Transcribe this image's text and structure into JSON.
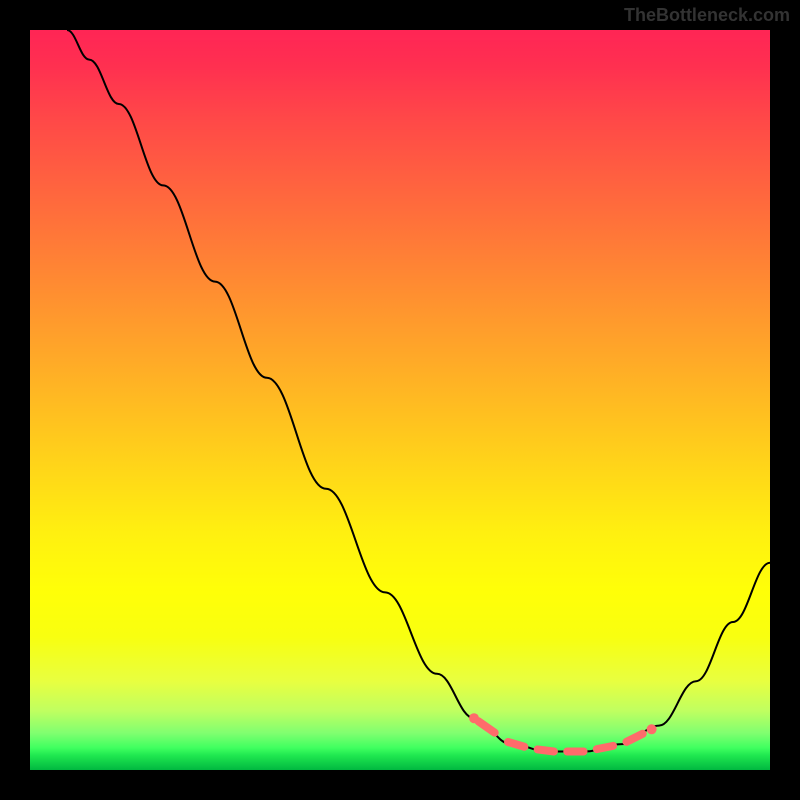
{
  "watermark": "TheBottleneck.com",
  "chart_data": {
    "type": "line",
    "title": "",
    "xlabel": "",
    "ylabel": "",
    "xlim": [
      0,
      100
    ],
    "ylim": [
      0,
      100
    ],
    "curve_points": [
      {
        "x": 5,
        "y": 100
      },
      {
        "x": 8,
        "y": 96
      },
      {
        "x": 12,
        "y": 90
      },
      {
        "x": 18,
        "y": 79
      },
      {
        "x": 25,
        "y": 66
      },
      {
        "x": 32,
        "y": 53
      },
      {
        "x": 40,
        "y": 38
      },
      {
        "x": 48,
        "y": 24
      },
      {
        "x": 55,
        "y": 13
      },
      {
        "x": 60,
        "y": 7
      },
      {
        "x": 65,
        "y": 3.5
      },
      {
        "x": 70,
        "y": 2.5
      },
      {
        "x": 75,
        "y": 2.5
      },
      {
        "x": 80,
        "y": 3.5
      },
      {
        "x": 85,
        "y": 6
      },
      {
        "x": 90,
        "y": 12
      },
      {
        "x": 95,
        "y": 20
      },
      {
        "x": 100,
        "y": 28
      }
    ],
    "highlight_region": {
      "x_start": 60,
      "x_end": 84,
      "description": "Optimal range markers"
    }
  }
}
